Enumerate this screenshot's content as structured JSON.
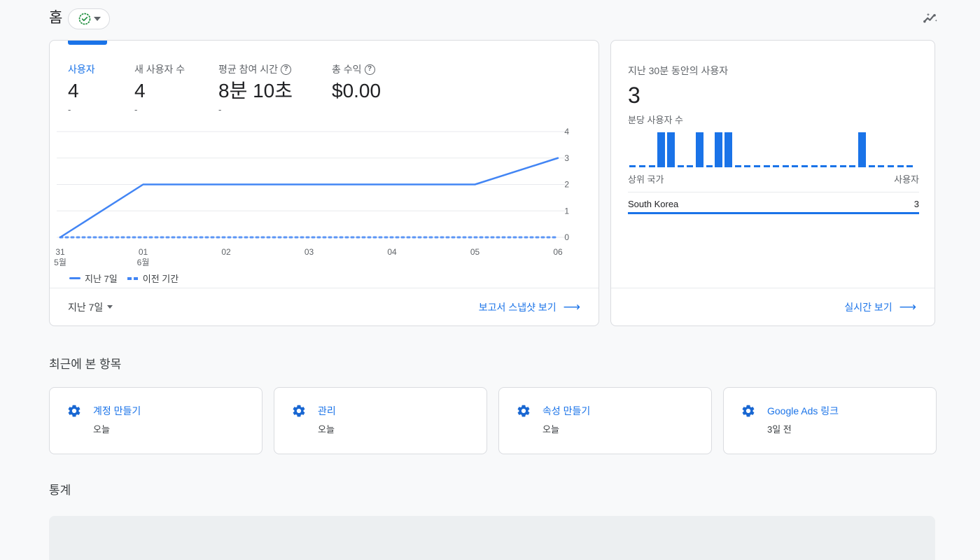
{
  "header": {
    "title": "홈",
    "account_chip": {
      "verified_icon": "verified-check-icon",
      "caret_icon": "chevron-down-icon"
    },
    "insights_icon": "insights-trend-icon"
  },
  "overview": {
    "metrics": [
      {
        "label": "사용자",
        "value": "4",
        "delta": "-",
        "active": true,
        "has_help": false
      },
      {
        "label": "새 사용자 수",
        "value": "4",
        "delta": "-",
        "active": false,
        "has_help": false
      },
      {
        "label": "평균 참여 시간",
        "value": "8분 10초",
        "delta": "-",
        "active": false,
        "has_help": true
      },
      {
        "label": "총 수익",
        "value": "$0.00",
        "delta": "",
        "active": false,
        "has_help": true
      }
    ],
    "legend": [
      {
        "label": "지난 7일",
        "style": "solid"
      },
      {
        "label": "이전 기간",
        "style": "dashed"
      }
    ],
    "footer": {
      "range_label": "지난 7일",
      "link_label": "보고서 스냅샷 보기"
    }
  },
  "realtime": {
    "label": "지난 30분 동안의 사용자",
    "value": "3",
    "sparkline_label": "분당 사용자 수",
    "sparkline": [
      0,
      0,
      0,
      1,
      1,
      0,
      0,
      1,
      0,
      1,
      1,
      0,
      0,
      0,
      0,
      0,
      0,
      0,
      0,
      0,
      0,
      0,
      0,
      0,
      1,
      0,
      0,
      0,
      0,
      0
    ],
    "table": {
      "headers": [
        "상위 국가",
        "사용자"
      ],
      "rows": [
        {
          "country": "South Korea",
          "users": "3"
        }
      ]
    },
    "link_label": "실시간 보기"
  },
  "recent": {
    "title": "최근에 본 항목",
    "items": [
      {
        "icon": "gear-icon",
        "title": "계정 만들기",
        "time": "오늘"
      },
      {
        "icon": "gear-icon",
        "title": "관리",
        "time": "오늘"
      },
      {
        "icon": "gear-icon",
        "title": "속성 만들기",
        "time": "오늘"
      },
      {
        "icon": "gear-icon",
        "title": "Google Ads 링크",
        "time": "3일 전"
      }
    ]
  },
  "stats": {
    "title": "통계"
  },
  "colors": {
    "accent": "#1a73e8",
    "line": "#4285f4",
    "page_bg": "#f8f9fa",
    "border": "#dadce0",
    "verified_green": "#1e8e3e"
  },
  "chart_data": {
    "type": "line",
    "title": "사용자",
    "x": [
      "31\n5월",
      "01\n6월",
      "02",
      "03",
      "04",
      "05",
      "06"
    ],
    "xtick_labels": [
      {
        "day": "31",
        "month": "5월"
      },
      {
        "day": "01",
        "month": "6월"
      },
      {
        "day": "02",
        "month": ""
      },
      {
        "day": "03",
        "month": ""
      },
      {
        "day": "04",
        "month": ""
      },
      {
        "day": "05",
        "month": ""
      },
      {
        "day": "06",
        "month": ""
      }
    ],
    "series": [
      {
        "name": "지난 7일",
        "style": "solid",
        "values": [
          0,
          2,
          2,
          2,
          2,
          2,
          3
        ]
      },
      {
        "name": "이전 기간",
        "style": "dashed",
        "values": [
          0,
          0,
          0,
          0,
          0,
          0,
          0
        ]
      }
    ],
    "ytick_labels": [
      "0",
      "1",
      "2",
      "3",
      "4"
    ],
    "ylim": [
      0,
      4
    ],
    "xlabel": "",
    "ylabel": "",
    "grid": true,
    "legend_position": "bottom-left"
  }
}
